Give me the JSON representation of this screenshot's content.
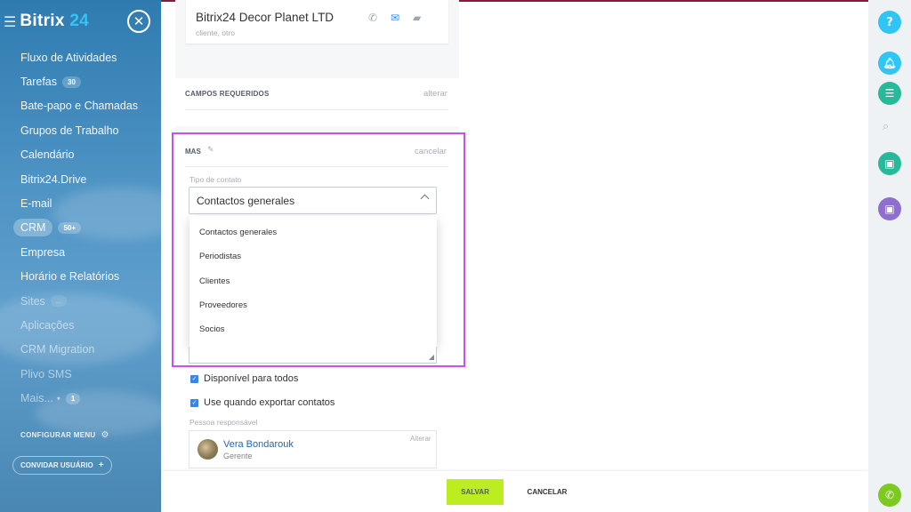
{
  "sidebar": {
    "logo": "Bitrix",
    "logo_num": "24",
    "items": [
      {
        "label": "Fluxo de Atividades"
      },
      {
        "label": "Tarefas",
        "badge": "30"
      },
      {
        "label": "Bate-papo e Chamadas"
      },
      {
        "label": "Grupos de Trabalho"
      },
      {
        "label": "Calendário"
      },
      {
        "label": "Bitrix24.Drive"
      },
      {
        "label": "E-mail"
      },
      {
        "label": "CRM",
        "badge": "50+"
      },
      {
        "label": "Empresa"
      },
      {
        "label": "Horário e Relatórios"
      },
      {
        "label": "Sites",
        "badge": "..."
      },
      {
        "label": "Aplicações"
      },
      {
        "label": "CRM Migration"
      },
      {
        "label": "Plivo SMS"
      },
      {
        "label": "Mais...",
        "badge": "1"
      }
    ],
    "configure": "CONFIGURAR MENU",
    "invite": "CONVIDAR USUÁRIO"
  },
  "company": {
    "name": "Bitrix24 Decor Planet LTD",
    "subtitle": "cliente, otro"
  },
  "required_section": {
    "title": "CAMPOS REQUERIDOS",
    "link": "alterar"
  },
  "mas_section": {
    "title": "MAS",
    "cancel": "cancelar",
    "field_label": "Tipo de contato",
    "selected": "Contactos generales",
    "options": [
      "Contactos generales",
      "Periodistas",
      "Clientes",
      "Proveedores",
      "Socios"
    ]
  },
  "checks": {
    "available": "Disponível para todos",
    "export": "Use quando exportar contatos"
  },
  "responsible": {
    "label": "Pessoa responsável",
    "name": "Vera Bondarouk",
    "role": "Gerente",
    "alter": "Alterar"
  },
  "footer": {
    "save": "SALVAR",
    "cancel": "CANCELAR"
  },
  "rightbar": {
    "help": "?",
    "colors": {
      "help": "#2fc6f6",
      "notify": "#2fc6f6",
      "chat": "#2fc6f6",
      "lock_green": "#26b99a",
      "lock_purple": "#8e6fd0",
      "phone": "#7cc91f"
    }
  }
}
